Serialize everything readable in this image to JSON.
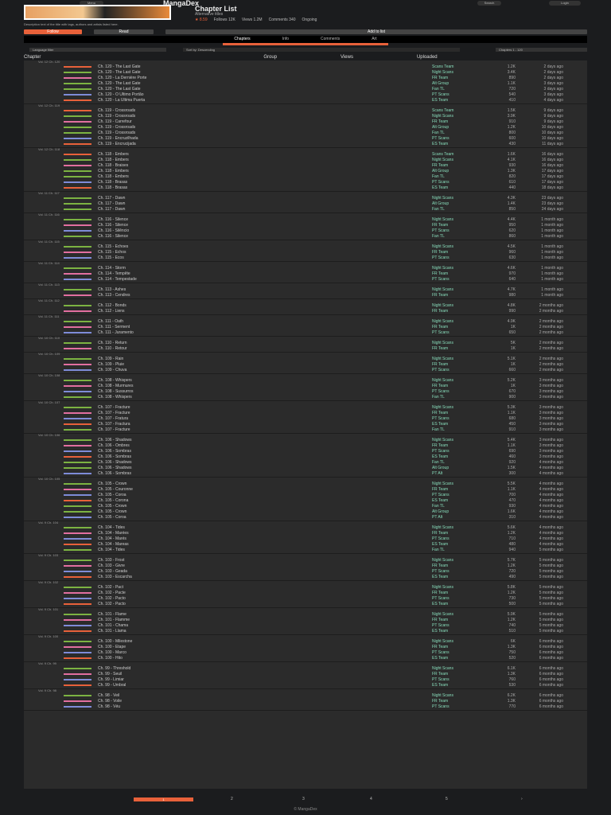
{
  "nav": {
    "logo": "MangaDex",
    "menu": "Menu",
    "search": "Search",
    "login": "Login"
  },
  "manga": {
    "title": "Chapter List",
    "alt": "Alternative titles",
    "stats": [
      "★ 8.59",
      "Follows 12K",
      "Views 1.2M",
      "Comments 340"
    ],
    "desc": "Description text of the title with tags, authors and artists listed here.",
    "status": "Ongoing"
  },
  "buttons": {
    "follow": "Follow",
    "read": "Read",
    "more": "Add to list"
  },
  "tabs": {
    "chapters": "Chapters",
    "info": "Info",
    "comments": "Comments",
    "art": "Art"
  },
  "filters": {
    "lang": "Language filter",
    "sort": "Sort by: Descending",
    "range": "Chapters 1 - 120"
  },
  "list_header": [
    "Chapter",
    "Group",
    "Views",
    "Uploaded"
  ],
  "colors": {
    "accent": "#e8613a",
    "en": "#7cb342",
    "es": "#e8613a",
    "fr": "#e26fa0",
    "pt": "#7e8cd8"
  },
  "groups": [
    {
      "h": "Vol. 12 Ch. 120",
      "rows": [
        [
          "es",
          "Ch. 120 - The Last Gate",
          "Scans Team",
          "1.2K",
          "2 days ago"
        ],
        [
          "en",
          "Ch. 120 - The Last Gate",
          "Night Scans",
          "3.4K",
          "2 days ago"
        ],
        [
          "fr",
          "Ch. 120 - La Dernière Porte",
          "FR Team",
          "890",
          "2 days ago"
        ],
        [
          "en",
          "Ch. 120 - The Last Gate",
          "Alt Group",
          "1.1K",
          "3 days ago"
        ],
        [
          "en",
          "Ch. 120 - The Last Gate",
          "Fan TL",
          "720",
          "3 days ago"
        ],
        [
          "pt",
          "Ch. 120 - O Último Portão",
          "PT Scans",
          "540",
          "3 days ago"
        ],
        [
          "es",
          "Ch. 120 - La Última Puerta",
          "ES Team",
          "410",
          "4 days ago"
        ]
      ]
    },
    {
      "h": "Vol. 12 Ch. 119",
      "rows": [
        [
          "es",
          "Ch. 119 - Crossroads",
          "Scans Team",
          "1.5K",
          "9 days ago"
        ],
        [
          "en",
          "Ch. 119 - Crossroads",
          "Night Scans",
          "3.9K",
          "9 days ago"
        ],
        [
          "fr",
          "Ch. 119 - Carrefour",
          "FR Team",
          "910",
          "9 days ago"
        ],
        [
          "en",
          "Ch. 119 - Crossroads",
          "Alt Group",
          "1.2K",
          "10 days ago"
        ],
        [
          "en",
          "Ch. 119 - Crossroads",
          "Fan TL",
          "800",
          "10 days ago"
        ],
        [
          "pt",
          "Ch. 119 - Encruzilhada",
          "PT Scans",
          "600",
          "10 days ago"
        ],
        [
          "es",
          "Ch. 119 - Encrucijada",
          "ES Team",
          "430",
          "11 days ago"
        ]
      ]
    },
    {
      "h": "Vol. 12 Ch. 118",
      "rows": [
        [
          "es",
          "Ch. 118 - Embers",
          "Scans Team",
          "1.6K",
          "16 days ago"
        ],
        [
          "en",
          "Ch. 118 - Embers",
          "Night Scans",
          "4.1K",
          "16 days ago"
        ],
        [
          "fr",
          "Ch. 118 - Braises",
          "FR Team",
          "930",
          "16 days ago"
        ],
        [
          "en",
          "Ch. 118 - Embers",
          "Alt Group",
          "1.3K",
          "17 days ago"
        ],
        [
          "en",
          "Ch. 118 - Embers",
          "Fan TL",
          "820",
          "17 days ago"
        ],
        [
          "pt",
          "Ch. 118 - Brasas",
          "PT Scans",
          "610",
          "17 days ago"
        ],
        [
          "es",
          "Ch. 118 - Brasas",
          "ES Team",
          "440",
          "18 days ago"
        ]
      ]
    },
    {
      "h": "Vol. 11 Ch. 117",
      "rows": [
        [
          "en",
          "Ch. 117 - Dawn",
          "Night Scans",
          "4.3K",
          "23 days ago"
        ],
        [
          "en",
          "Ch. 117 - Dawn",
          "Alt Group",
          "1.4K",
          "23 days ago"
        ],
        [
          "en",
          "Ch. 117 - Dawn",
          "Fan TL",
          "850",
          "24 days ago"
        ]
      ]
    },
    {
      "h": "Vol. 11 Ch. 116",
      "rows": [
        [
          "en",
          "Ch. 116 - Silence",
          "Night Scans",
          "4.4K",
          "1 month ago"
        ],
        [
          "fr",
          "Ch. 116 - Silence",
          "FR Team",
          "950",
          "1 month ago"
        ],
        [
          "pt",
          "Ch. 116 - Silêncio",
          "PT Scans",
          "620",
          "1 month ago"
        ],
        [
          "en",
          "Ch. 116 - Silence",
          "Fan TL",
          "860",
          "1 month ago"
        ]
      ]
    },
    {
      "h": "Vol. 11 Ch. 115",
      "rows": [
        [
          "en",
          "Ch. 115 - Echoes",
          "Night Scans",
          "4.5K",
          "1 month ago"
        ],
        [
          "fr",
          "Ch. 115 - Échos",
          "FR Team",
          "960",
          "1 month ago"
        ],
        [
          "pt",
          "Ch. 115 - Ecos",
          "PT Scans",
          "630",
          "1 month ago"
        ]
      ]
    },
    {
      "h": "Vol. 11 Ch. 114",
      "rows": [
        [
          "en",
          "Ch. 114 - Storm",
          "Night Scans",
          "4.6K",
          "1 month ago"
        ],
        [
          "fr",
          "Ch. 114 - Tempête",
          "FR Team",
          "970",
          "1 month ago"
        ],
        [
          "pt",
          "Ch. 114 - Tempestade",
          "PT Scans",
          "640",
          "1 month ago"
        ]
      ]
    },
    {
      "h": "Vol. 11 Ch. 113",
      "rows": [
        [
          "en",
          "Ch. 113 - Ashes",
          "Night Scans",
          "4.7K",
          "1 month ago"
        ],
        [
          "fr",
          "Ch. 113 - Cendres",
          "FR Team",
          "980",
          "1 month ago"
        ]
      ]
    },
    {
      "h": "Vol. 11 Ch. 112",
      "rows": [
        [
          "en",
          "Ch. 112 - Bonds",
          "Night Scans",
          "4.8K",
          "2 months ago"
        ],
        [
          "fr",
          "Ch. 112 - Liens",
          "FR Team",
          "990",
          "2 months ago"
        ]
      ]
    },
    {
      "h": "Vol. 11 Ch. 111",
      "rows": [
        [
          "en",
          "Ch. 111 - Oath",
          "Night Scans",
          "4.9K",
          "2 months ago"
        ],
        [
          "fr",
          "Ch. 111 - Serment",
          "FR Team",
          "1K",
          "2 months ago"
        ],
        [
          "pt",
          "Ch. 111 - Juramento",
          "PT Scans",
          "650",
          "2 months ago"
        ]
      ]
    },
    {
      "h": "Vol. 10 Ch. 110",
      "rows": [
        [
          "en",
          "Ch. 110 - Return",
          "Night Scans",
          "5K",
          "2 months ago"
        ],
        [
          "fr",
          "Ch. 110 - Retour",
          "FR Team",
          "1K",
          "2 months ago"
        ]
      ]
    },
    {
      "h": "Vol. 10 Ch. 109",
      "rows": [
        [
          "en",
          "Ch. 109 - Rain",
          "Night Scans",
          "5.1K",
          "2 months ago"
        ],
        [
          "fr",
          "Ch. 109 - Pluie",
          "FR Team",
          "1K",
          "2 months ago"
        ],
        [
          "pt",
          "Ch. 109 - Chuva",
          "PT Scans",
          "660",
          "2 months ago"
        ]
      ]
    },
    {
      "h": "Vol. 10 Ch. 108",
      "rows": [
        [
          "en",
          "Ch. 108 - Whispers",
          "Night Scans",
          "5.2K",
          "3 months ago"
        ],
        [
          "fr",
          "Ch. 108 - Murmures",
          "FR Team",
          "1K",
          "3 months ago"
        ],
        [
          "pt",
          "Ch. 108 - Sussurros",
          "PT Scans",
          "670",
          "3 months ago"
        ],
        [
          "en",
          "Ch. 108 - Whispers",
          "Fan TL",
          "900",
          "3 months ago"
        ]
      ]
    },
    {
      "h": "Vol. 10 Ch. 107",
      "rows": [
        [
          "en",
          "Ch. 107 - Fracture",
          "Night Scans",
          "5.3K",
          "3 months ago"
        ],
        [
          "fr",
          "Ch. 107 - Fracture",
          "FR Team",
          "1.1K",
          "3 months ago"
        ],
        [
          "pt",
          "Ch. 107 - Fratura",
          "PT Scans",
          "680",
          "3 months ago"
        ],
        [
          "es",
          "Ch. 107 - Fractura",
          "ES Team",
          "450",
          "3 months ago"
        ],
        [
          "en",
          "Ch. 107 - Fracture",
          "Fan TL",
          "910",
          "3 months ago"
        ]
      ]
    },
    {
      "h": "Vol. 10 Ch. 106",
      "rows": [
        [
          "en",
          "Ch. 106 - Shadows",
          "Night Scans",
          "5.4K",
          "3 months ago"
        ],
        [
          "fr",
          "Ch. 106 - Ombres",
          "FR Team",
          "1.1K",
          "3 months ago"
        ],
        [
          "pt",
          "Ch. 106 - Sombras",
          "PT Scans",
          "690",
          "3 months ago"
        ],
        [
          "es",
          "Ch. 106 - Sombras",
          "ES Team",
          "460",
          "3 months ago"
        ],
        [
          "en",
          "Ch. 106 - Shadows",
          "Fan TL",
          "920",
          "4 months ago"
        ],
        [
          "en",
          "Ch. 106 - Shadows",
          "Alt Group",
          "1.5K",
          "4 months ago"
        ],
        [
          "pt",
          "Ch. 106 - Sombras",
          "PT Alt",
          "300",
          "4 months ago"
        ]
      ]
    },
    {
      "h": "Vol. 10 Ch. 105",
      "rows": [
        [
          "en",
          "Ch. 105 - Crown",
          "Night Scans",
          "5.5K",
          "4 months ago"
        ],
        [
          "fr",
          "Ch. 105 - Couronne",
          "FR Team",
          "1.1K",
          "4 months ago"
        ],
        [
          "pt",
          "Ch. 105 - Coroa",
          "PT Scans",
          "700",
          "4 months ago"
        ],
        [
          "es",
          "Ch. 105 - Corona",
          "ES Team",
          "470",
          "4 months ago"
        ],
        [
          "en",
          "Ch. 105 - Crown",
          "Fan TL",
          "930",
          "4 months ago"
        ],
        [
          "en",
          "Ch. 105 - Crown",
          "Alt Group",
          "1.6K",
          "4 months ago"
        ],
        [
          "pt",
          "Ch. 105 - Coroa",
          "PT Alt",
          "310",
          "4 months ago"
        ]
      ]
    },
    {
      "h": "Vol. 9 Ch. 104",
      "rows": [
        [
          "en",
          "Ch. 104 - Tides",
          "Night Scans",
          "5.6K",
          "4 months ago"
        ],
        [
          "fr",
          "Ch. 104 - Marées",
          "FR Team",
          "1.2K",
          "4 months ago"
        ],
        [
          "pt",
          "Ch. 104 - Marés",
          "PT Scans",
          "710",
          "4 months ago"
        ],
        [
          "es",
          "Ch. 104 - Mareas",
          "ES Team",
          "480",
          "4 months ago"
        ],
        [
          "en",
          "Ch. 104 - Tides",
          "Fan TL",
          "940",
          "5 months ago"
        ]
      ]
    },
    {
      "h": "Vol. 9 Ch. 103",
      "rows": [
        [
          "en",
          "Ch. 103 - Frost",
          "Night Scans",
          "5.7K",
          "5 months ago"
        ],
        [
          "fr",
          "Ch. 103 - Givre",
          "FR Team",
          "1.2K",
          "5 months ago"
        ],
        [
          "pt",
          "Ch. 103 - Geada",
          "PT Scans",
          "720",
          "5 months ago"
        ],
        [
          "es",
          "Ch. 103 - Escarcha",
          "ES Team",
          "490",
          "5 months ago"
        ]
      ]
    },
    {
      "h": "Vol. 9 Ch. 102",
      "rows": [
        [
          "en",
          "Ch. 102 - Pact",
          "Night Scans",
          "5.8K",
          "5 months ago"
        ],
        [
          "fr",
          "Ch. 102 - Pacte",
          "FR Team",
          "1.2K",
          "5 months ago"
        ],
        [
          "pt",
          "Ch. 102 - Pacto",
          "PT Scans",
          "730",
          "5 months ago"
        ],
        [
          "es",
          "Ch. 102 - Pacto",
          "ES Team",
          "500",
          "5 months ago"
        ]
      ]
    },
    {
      "h": "Vol. 9 Ch. 101",
      "rows": [
        [
          "en",
          "Ch. 101 - Flame",
          "Night Scans",
          "5.9K",
          "5 months ago"
        ],
        [
          "fr",
          "Ch. 101 - Flamme",
          "FR Team",
          "1.2K",
          "5 months ago"
        ],
        [
          "pt",
          "Ch. 101 - Chama",
          "PT Scans",
          "740",
          "5 months ago"
        ],
        [
          "es",
          "Ch. 101 - Llama",
          "ES Team",
          "510",
          "5 months ago"
        ]
      ]
    },
    {
      "h": "Vol. 9 Ch. 100",
      "rows": [
        [
          "en",
          "Ch. 100 - Milestone",
          "Night Scans",
          "6K",
          "6 months ago"
        ],
        [
          "fr",
          "Ch. 100 - Étape",
          "FR Team",
          "1.3K",
          "6 months ago"
        ],
        [
          "pt",
          "Ch. 100 - Marco",
          "PT Scans",
          "750",
          "6 months ago"
        ],
        [
          "es",
          "Ch. 100 - Hito",
          "ES Team",
          "520",
          "6 months ago"
        ]
      ]
    },
    {
      "h": "Vol. 9 Ch. 99",
      "rows": [
        [
          "en",
          "Ch. 99 - Threshold",
          "Night Scans",
          "6.1K",
          "6 months ago"
        ],
        [
          "fr",
          "Ch. 99 - Seuil",
          "FR Team",
          "1.3K",
          "6 months ago"
        ],
        [
          "pt",
          "Ch. 99 - Limiar",
          "PT Scans",
          "760",
          "6 months ago"
        ],
        [
          "es",
          "Ch. 99 - Umbral",
          "ES Team",
          "530",
          "6 months ago"
        ]
      ]
    },
    {
      "h": "Vol. 9 Ch. 98",
      "rows": [
        [
          "en",
          "Ch. 98 - Veil",
          "Night Scans",
          "6.2K",
          "6 months ago"
        ],
        [
          "fr",
          "Ch. 98 - Voile",
          "FR Team",
          "1.3K",
          "6 months ago"
        ],
        [
          "pt",
          "Ch. 98 - Véu",
          "PT Scans",
          "770",
          "6 months ago"
        ]
      ]
    }
  ],
  "pagination": {
    "current": "1",
    "pages": [
      "2",
      "3",
      "4",
      "5"
    ],
    "next": "›"
  },
  "footer": "© MangaDex"
}
